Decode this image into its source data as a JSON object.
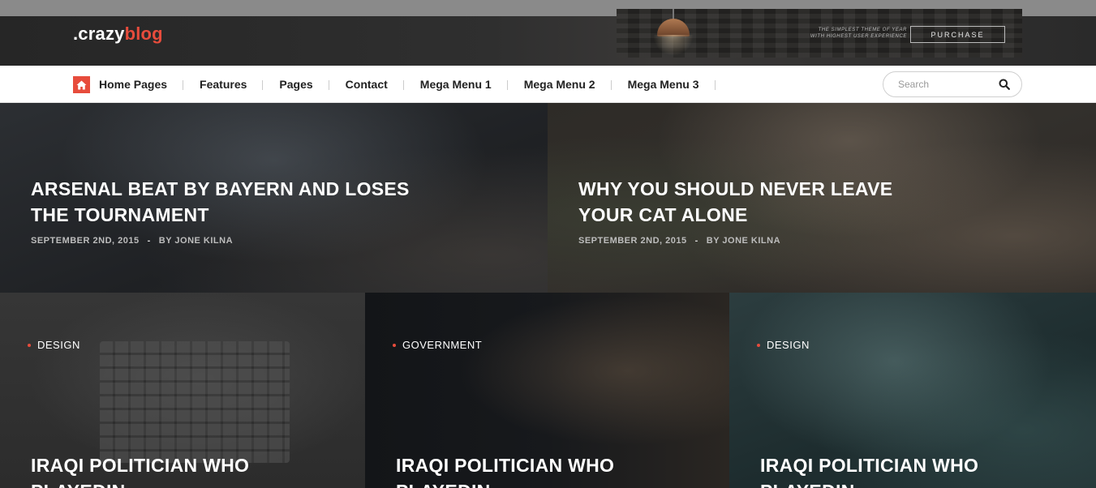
{
  "header": {
    "logo_prefix": ".crazy",
    "logo_brand": "blog",
    "ad": {
      "tagline_1": "THE SIMPLEST THEME OF YEAR",
      "tagline_2": "WITH HIGHEST USER EXPERIENCE",
      "button_label": "PURCHASE"
    }
  },
  "nav": {
    "items": [
      {
        "label": "Home Pages"
      },
      {
        "label": "Features"
      },
      {
        "label": "Pages"
      },
      {
        "label": "Contact"
      },
      {
        "label": "Mega Menu 1"
      },
      {
        "label": "Mega Menu 2"
      },
      {
        "label": "Mega Menu 3"
      }
    ],
    "search_placeholder": "Search"
  },
  "hero": [
    {
      "title": "ARSENAL BEAT BY BAYERN AND LOSES THE TOURNAMENT",
      "date": "SEPTEMBER 2ND, 2015",
      "separator": "-",
      "author": "BY JONE KILNA"
    },
    {
      "title": "WHY YOU SHOULD NEVER LEAVE YOUR CAT ALONE",
      "date": "SEPTEMBER 2ND, 2015",
      "separator": "-",
      "author": "BY JONE KILNA"
    }
  ],
  "cards": [
    {
      "category": "DESIGN",
      "title": "IRAQI POLITICIAN WHO PLAYEDIN"
    },
    {
      "category": "GOVERNMENT",
      "title": "IRAQI POLITICIAN WHO PLAYEDIN"
    },
    {
      "category": "DESIGN",
      "title": "IRAQI POLITICIAN WHO PLAYEDIN"
    }
  ],
  "colors": {
    "accent": "#e74c3c",
    "nav_background": "#ffffff",
    "header_background": "#2f2f2f"
  }
}
